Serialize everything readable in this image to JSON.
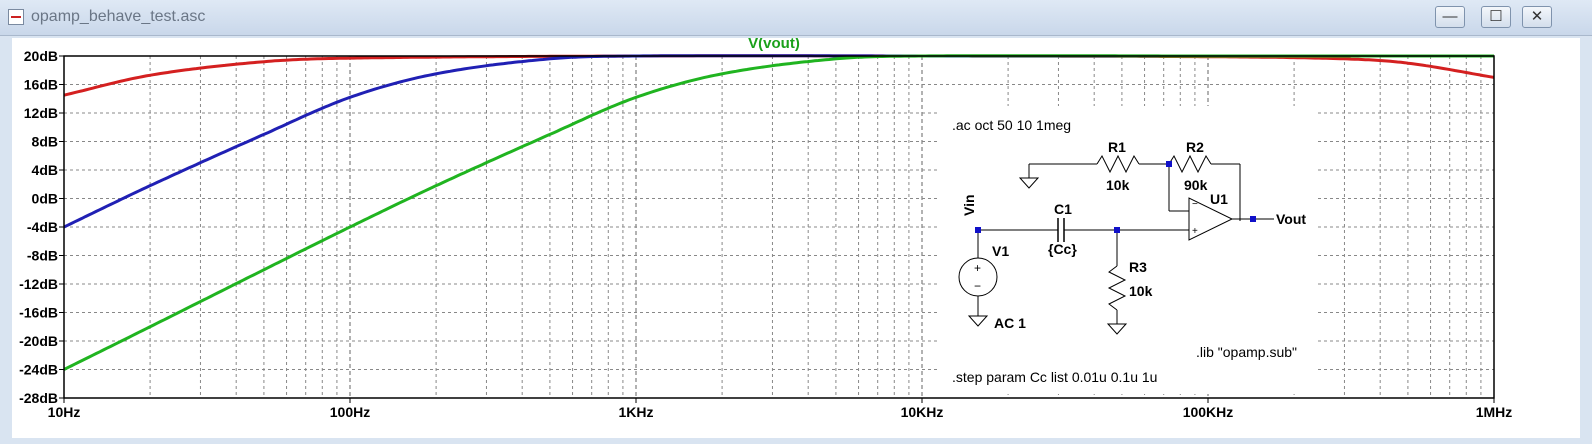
{
  "window": {
    "title": "opamp_behave_test.asc",
    "minimize_glyph": "—",
    "maximize_glyph": "☐",
    "close_glyph": "✕"
  },
  "chart_data": {
    "type": "line",
    "title": "V(vout)",
    "x_scale": "log",
    "xlim": [
      10,
      1000000
    ],
    "ylim": [
      -28,
      20
    ],
    "x_ticks": [
      "10Hz",
      "100Hz",
      "1KHz",
      "10KHz",
      "100KHz",
      "1MHz"
    ],
    "y_ticks": [
      "20dB",
      "16dB",
      "12dB",
      "8dB",
      "4dB",
      "0dB",
      "-4dB",
      "-8dB",
      "-12dB",
      "-16dB",
      "-20dB",
      "-24dB",
      "-28dB"
    ],
    "grid": true,
    "series": [
      {
        "color": "#d42020",
        "x": [
          10,
          20,
          50,
          100,
          1000,
          10000,
          100000,
          300000,
          500000,
          1000000
        ],
        "y": [
          14.5,
          17.3,
          19.2,
          19.7,
          20.0,
          20.0,
          19.9,
          19.6,
          19.0,
          17.0
        ]
      },
      {
        "color": "#2020b4",
        "x": [
          10,
          20,
          50,
          100,
          200,
          500,
          1000,
          10000,
          100000,
          1000000
        ],
        "y": [
          -4.0,
          1.8,
          9.0,
          14.2,
          17.5,
          19.6,
          20.0,
          20.0,
          20.0,
          20.0
        ]
      },
      {
        "color": "#20b420",
        "x": [
          10,
          20,
          50,
          100,
          200,
          500,
          1000,
          2000,
          5000,
          10000,
          100000,
          1000000
        ],
        "y": [
          -24.0,
          -18.0,
          -10.0,
          -4.0,
          1.8,
          9.0,
          14.2,
          17.5,
          19.6,
          20.0,
          20.0,
          20.0
        ]
      }
    ]
  },
  "schematic": {
    "ac_directive": ".ac oct 50 10 1meg",
    "lib_directive": ".lib \"opamp.sub\"",
    "step_directive": ".step param Cc list 0.01u 0.1u 1u",
    "r1_name": "R1",
    "r1_value": "10k",
    "r2_name": "R2",
    "r2_value": "90k",
    "r3_name": "R3",
    "r3_value": "10k",
    "c1_name": "C1",
    "c1_value": "{Cc}",
    "u1_name": "U1",
    "v1_name": "V1",
    "v1_value": "AC 1",
    "vin_label": "Vin",
    "vout_label": "Vout",
    "plus_sign": "+",
    "minus_sign": "−"
  }
}
